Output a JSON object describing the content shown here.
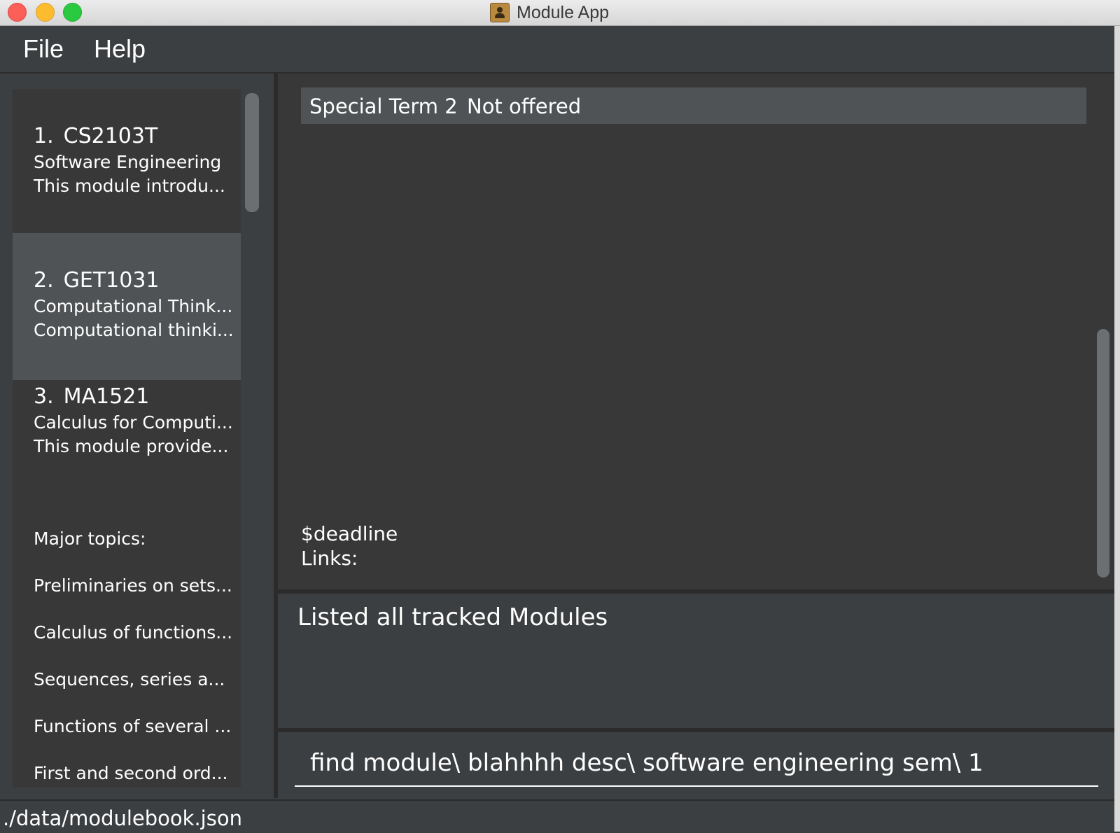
{
  "window": {
    "title": "Module App",
    "app_icon": "address-book-icon"
  },
  "menu": {
    "items": [
      "File",
      "Help"
    ]
  },
  "module_list": [
    {
      "index": "1.",
      "code": "CS2103T",
      "title": "Software Engineering",
      "desc": "This module introdu..."
    },
    {
      "index": "2.",
      "code": "GET1031",
      "title": "Computational Think...",
      "desc": "Computational thinki...",
      "selected": true
    },
    {
      "index": "3.",
      "code": "MA1521",
      "title": "Calculus for Computi...",
      "desc": "This module provide..."
    }
  ],
  "module_extra_lines": [
    "Major topics:",
    "Preliminaries on sets...",
    "Calculus of functions...",
    "Sequences, series a...",
    "Functions of several ...",
    "First and second ord..."
  ],
  "detail": {
    "semester_row": {
      "label": "Special Term 2",
      "value": "Not offered"
    },
    "deadline": "$deadline",
    "links": "Links:"
  },
  "result": {
    "message": "Listed all tracked Modules"
  },
  "command": {
    "value": "find module\\ blahhhh desc\\ software engineering sem\\ 1"
  },
  "status": {
    "path": "./data/modulebook.json"
  },
  "colors": {
    "background": "#3c3f41",
    "panel": "#383838",
    "selected": "#4f5356",
    "titlebar": "#e0e0e0"
  }
}
